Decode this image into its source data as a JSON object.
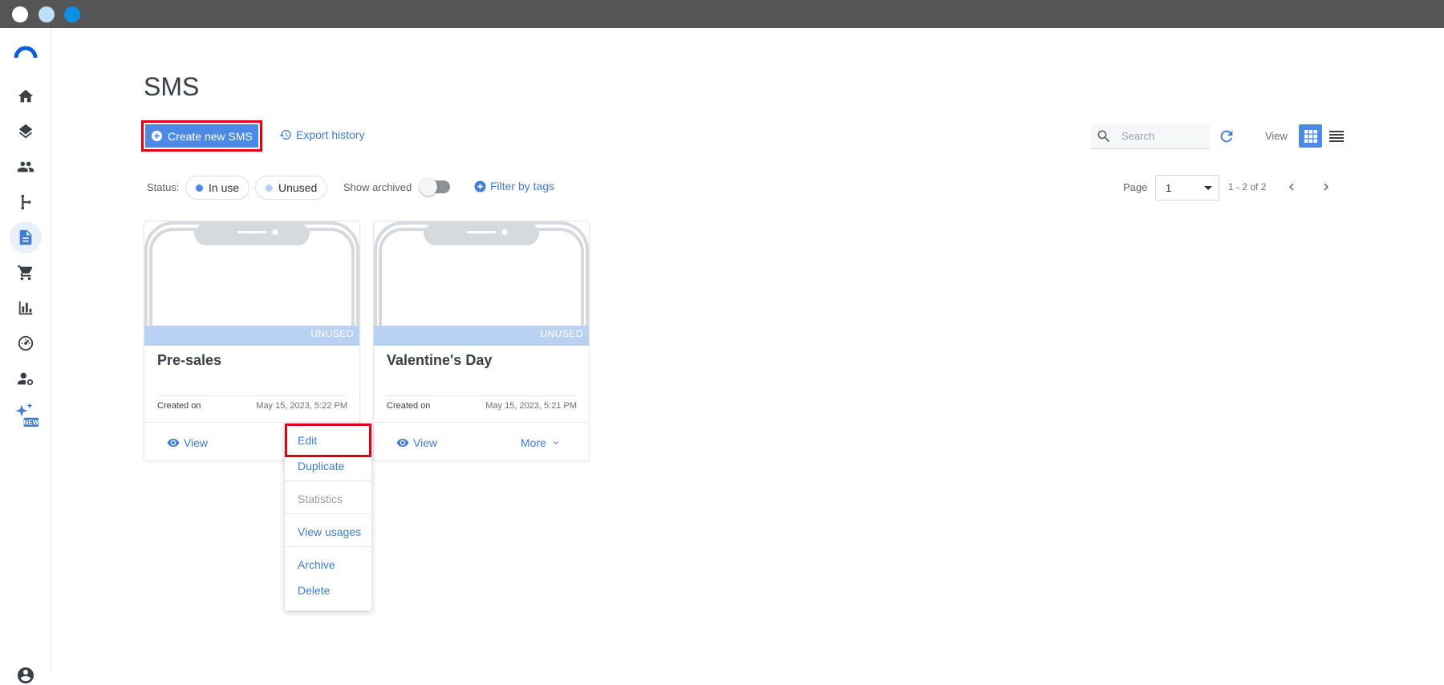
{
  "page": {
    "title": "SMS"
  },
  "toolbar": {
    "create_label": "Create new SMS",
    "export_label": "Export history",
    "search_placeholder": "Search",
    "view_label": "View"
  },
  "filters": {
    "status_label": "Status:",
    "in_use_label": "In use",
    "unused_label": "Unused",
    "show_archived_label": "Show archived",
    "filter_tags_label": "Filter by tags"
  },
  "pagination": {
    "page_label": "Page",
    "current_page": "1",
    "range_text": "1 - 2 of 2"
  },
  "cards": [
    {
      "badge": "UNUSED",
      "title": "Pre-sales",
      "created_label": "Created on",
      "created_value": "May 15, 2023, 5:22 PM",
      "view_label": "View",
      "more_label": "More"
    },
    {
      "badge": "UNUSED",
      "title": "Valentine's Day",
      "created_label": "Created on",
      "created_value": "May 15, 2023, 5:21 PM",
      "view_label": "View",
      "more_label": "More"
    }
  ],
  "menu": {
    "items": [
      "Edit",
      "Duplicate",
      "Statistics",
      "View usages",
      "Archive",
      "Delete"
    ]
  },
  "sidebar": {
    "items": [
      "home-icon",
      "layers-icon",
      "contacts-icon",
      "automation-icon",
      "templates-icon",
      "cart-icon",
      "reports-icon",
      "dashboard-icon",
      "user-settings-icon",
      "ai-new-icon"
    ],
    "new_badge": "NEW"
  },
  "colors": {
    "accent": "#4d8ae6",
    "link": "#3f7ddb",
    "highlight": "#e0001a",
    "in_use_dot": "#4d8ae6",
    "unused_dot": "#b9d1f2"
  }
}
